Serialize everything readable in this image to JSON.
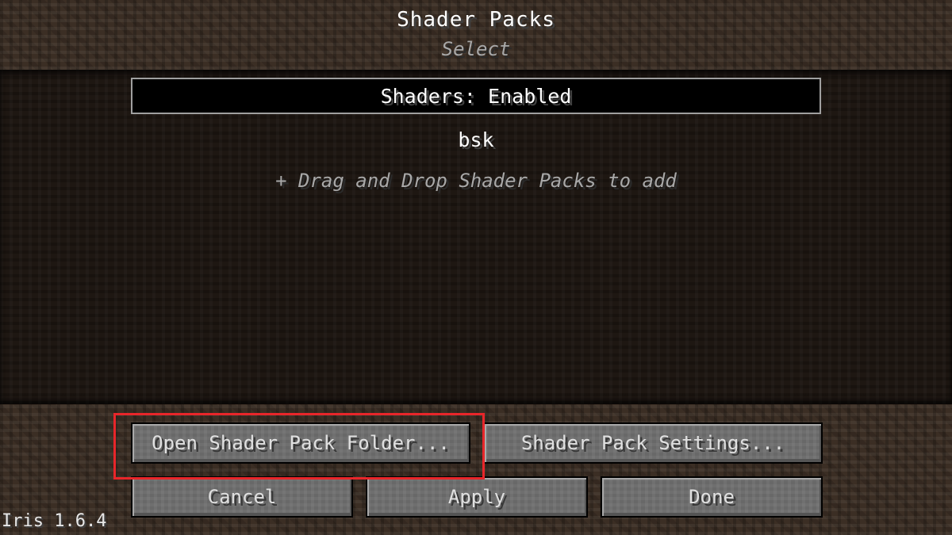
{
  "screen": {
    "title": "Shader Packs",
    "subtitle": "Select"
  },
  "pack_list": {
    "selected_entry": "Shaders: Enabled",
    "entries": [
      "bsk"
    ],
    "drop_hint": "+ Drag and Drop Shader Packs to add"
  },
  "buttons": {
    "open_folder": "Open Shader Pack Folder...",
    "settings": "Shader Pack Settings...",
    "cancel": "Cancel",
    "apply": "Apply",
    "done": "Done"
  },
  "footer": {
    "version": "Iris 1.6.4"
  },
  "colors": {
    "highlight": "#e8262a",
    "button_face": "#6f6f6f",
    "hint_text": "#a8a8a8"
  }
}
